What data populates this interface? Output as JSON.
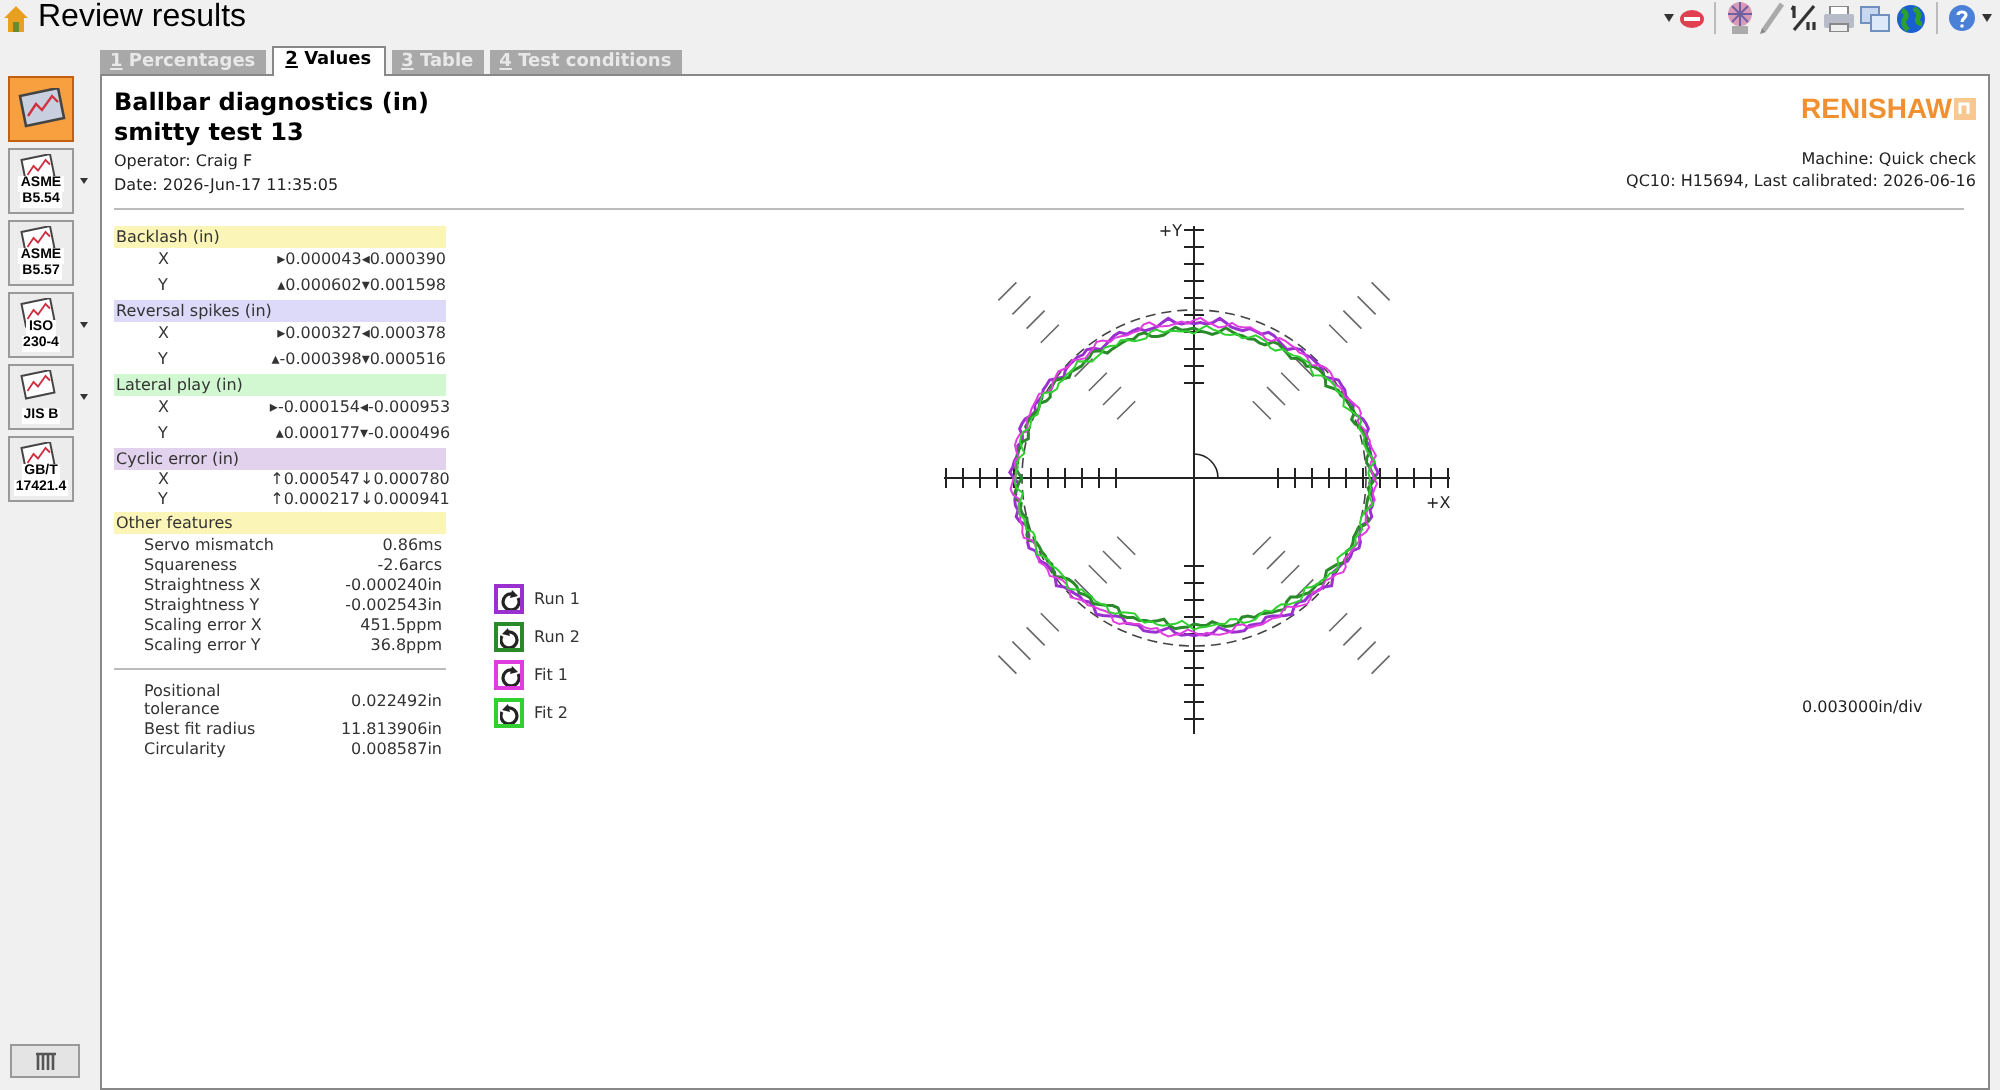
{
  "window": {
    "title": "Review results"
  },
  "sidebar": {
    "items": [
      {
        "selected": true,
        "has_menu": false
      },
      {
        "label_lines": [
          "ASME",
          "B5.54"
        ],
        "selected": false,
        "has_menu": true
      },
      {
        "label_lines": [
          "ASME",
          "B5.57"
        ],
        "selected": false,
        "has_menu": false
      },
      {
        "label_lines": [
          "ISO",
          "230-4"
        ],
        "selected": false,
        "has_menu": true
      },
      {
        "label_lines": [
          "JIS B"
        ],
        "selected": false,
        "has_menu": true
      },
      {
        "label_lines": [
          "GB/T",
          "17421.4"
        ],
        "selected": false,
        "has_menu": false
      }
    ]
  },
  "tabs": [
    {
      "number": "1",
      "label": "Percentages",
      "selected": false
    },
    {
      "number": "2",
      "label": "Values",
      "selected": true
    },
    {
      "number": "3",
      "label": "Table",
      "selected": false
    },
    {
      "number": "4",
      "label": "Test conditions",
      "selected": false
    }
  ],
  "report": {
    "title": "Ballbar diagnostics (in)",
    "test_name": "smitty test 13",
    "operator": "Operator: Craig F",
    "date": "Date: 2026-Jun-17 11:35:05",
    "logo": "RENISHAW",
    "machine": "Machine: Quick check",
    "calibration": "QC10: H15694, Last calibrated: 2026-06-16"
  },
  "sections": [
    {
      "title": "Backlash (in)",
      "color": "#fbf5b8",
      "rows": [
        {
          "axis": "X",
          "values": [
            "▸0.000043",
            "◂0.000390"
          ]
        },
        {
          "axis": "Y",
          "values": [
            "▴0.000602",
            "▾0.001598"
          ]
        }
      ]
    },
    {
      "title": "Reversal spikes (in)",
      "color": "#dcdaf8",
      "rows": [
        {
          "axis": "X",
          "values": [
            "▸0.000327",
            "◂0.000378"
          ]
        },
        {
          "axis": "Y",
          "values": [
            "▴-0.000398",
            "▾0.000516"
          ]
        }
      ]
    },
    {
      "title": "Lateral play (in)",
      "color": "#d2f8d2",
      "rows": [
        {
          "axis": "X",
          "values": [
            "▸-0.000154",
            "◂-0.000953"
          ]
        },
        {
          "axis": "Y",
          "values": [
            "▴0.000177",
            "▾-0.000496"
          ]
        }
      ]
    },
    {
      "title": "Cyclic error (in)",
      "color": "#e2d2ee",
      "rows": [
        {
          "axis": "X",
          "values": [
            "↑0.000547",
            "↓0.000780"
          ]
        },
        {
          "axis": "Y",
          "values": [
            "↑0.000217",
            "↓0.000941"
          ]
        }
      ]
    }
  ],
  "other_features": {
    "title": "Other features",
    "color": "#fbf5b8",
    "rows": [
      {
        "label": "Servo mismatch",
        "value": "0.86ms"
      },
      {
        "label": "Squareness",
        "value": "-2.6arcs"
      },
      {
        "label": "Straightness X",
        "value": "-0.000240in"
      },
      {
        "label": "Straightness Y",
        "value": "-0.002543in"
      },
      {
        "label": "Scaling error X",
        "value": "451.5ppm"
      },
      {
        "label": "Scaling error Y",
        "value": "36.8ppm"
      }
    ]
  },
  "summary": [
    {
      "label": "Positional tolerance",
      "value": "0.022492in"
    },
    {
      "label": "Best fit radius",
      "value": "11.813906in"
    },
    {
      "label": "Circularity",
      "value": "0.008587in"
    }
  ],
  "legend": [
    {
      "label": "Run 1",
      "color": "#9b30d0",
      "kind": "clockwise"
    },
    {
      "label": "Run 2",
      "color": "#2a8a2a",
      "kind": "anticlockwise"
    },
    {
      "label": "Fit 1",
      "color": "#e03ce0",
      "kind": "clockwise"
    },
    {
      "label": "Fit 2",
      "color": "#30d030",
      "kind": "anticlockwise"
    }
  ],
  "plot": {
    "y_axis_label": "+Y",
    "x_axis_label": "+X",
    "scale": "0.003000in/div"
  }
}
